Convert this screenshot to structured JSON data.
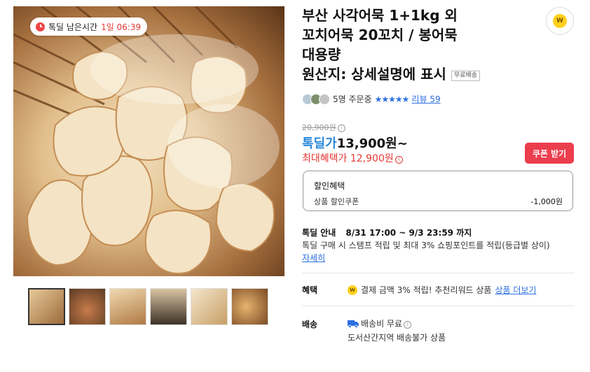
{
  "timer": {
    "label": "톡딜 남은시간",
    "value": "1일 06:39"
  },
  "product": {
    "title_lines": [
      "부산 사각어묵 1+1kg 외",
      "꼬치어묵 20꼬치 / 봉어묵",
      "대용량",
      "원산지: 상세설명에 표시"
    ],
    "free_shipping_tag": "무료배송"
  },
  "coin_badge": "W",
  "meta": {
    "ordering": "5명 주문중",
    "stars": "★★★★★",
    "review": "리뷰 59",
    "avatar_colors": [
      "#b9c9d6",
      "#7b8f6b",
      "#c4c4c4"
    ]
  },
  "price": {
    "original": "20,900원",
    "deal_label": "톡딜가",
    "deal_value": "13,900원~",
    "max_label": "최대혜택가",
    "max_value": "12,900원",
    "info_glyph": "i"
  },
  "coupon_button": "쿠폰 받기",
  "discount": {
    "title": "할인혜택",
    "item": "상품 할인쿠폰",
    "value": "-1,000원"
  },
  "deal_info": {
    "label": "톡딜 안내",
    "time": "8/31 17:00 ~ 9/3 23:59 까지",
    "description": "톡딜 구매 시 스탬프 적립 및 최대 3% 쇼핑포인트를 적립(등급별 상이)",
    "more_link": "자세히"
  },
  "benefit": {
    "label": "혜택",
    "coin": "W",
    "text": "결제 금액 3% 적립! 추천리워드 상품",
    "link": "상품 더보기"
  },
  "shipping": {
    "label": "배송",
    "fee": "배송비 무료",
    "note": "도서산간지역 배송불가 상품"
  },
  "thumbnails": [
    {
      "name": "thumb-1",
      "colors": [
        "#e8c99a",
        "#9c6a3a"
      ]
    },
    {
      "name": "thumb-2",
      "colors": [
        "#c77b4b",
        "#5a3a22"
      ]
    },
    {
      "name": "thumb-3",
      "colors": [
        "#f0d9b0",
        "#b07a44"
      ]
    },
    {
      "name": "thumb-4",
      "colors": [
        "#d9c3a2",
        "#3d3226"
      ]
    },
    {
      "name": "thumb-5",
      "colors": [
        "#f3e6cc",
        "#c99f66"
      ]
    },
    {
      "name": "thumb-6",
      "colors": [
        "#e6b36e",
        "#7a4a24"
      ]
    }
  ]
}
